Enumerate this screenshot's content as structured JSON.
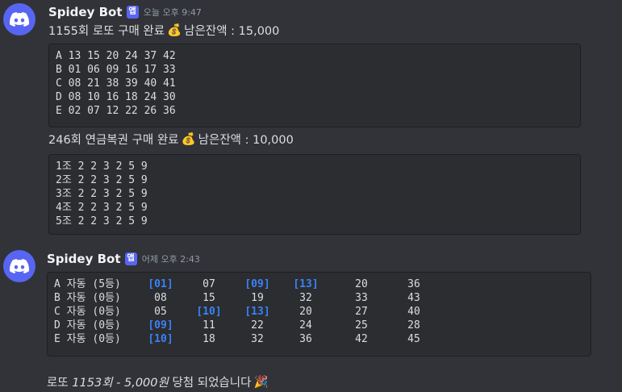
{
  "messages": [
    {
      "username": "Spidey Bot",
      "badge": "앱",
      "timestamp": "오늘 오후 9:47",
      "line1": {
        "text_a": "1155회 로또 구매 완료",
        "emoji": "💰",
        "text_b": "남은잔액 : 15,000"
      },
      "code1": [
        "A 13 15 20 24 37 42",
        "B 01 06 09 16 17 33",
        "C 08 21 38 39 40 41",
        "D 08 10 16 18 24 30",
        "E 02 07 12 22 26 36"
      ],
      "line2": {
        "text_a": "246회 연금복권 구매 완료",
        "emoji": "💰",
        "text_b": "남은잔액 : 10,000"
      },
      "code2": [
        "1조 2 2 3 2 5 9",
        "2조 2 2 3 2 5 9",
        "3조 2 2 3 2 5 9",
        "4조 2 2 3 2 5 9",
        "5조 2 2 3 2 5 9"
      ]
    },
    {
      "username": "Spidey Bot",
      "badge": "앱",
      "timestamp": "어제 오후 2:43",
      "table": [
        {
          "label": "A 자동 (5등)",
          "cells": [
            "[01]",
            "07",
            "[09]",
            "[13]",
            "20",
            "36"
          ],
          "hl": [
            true,
            false,
            true,
            true,
            false,
            false
          ]
        },
        {
          "label": "B 자동 (0등)",
          "cells": [
            "08",
            "15",
            "19",
            "32",
            "33",
            "43"
          ],
          "hl": [
            false,
            false,
            false,
            false,
            false,
            false
          ]
        },
        {
          "label": "C 자동 (0등)",
          "cells": [
            "05",
            "[10]",
            "[13]",
            "20",
            "27",
            "40"
          ],
          "hl": [
            false,
            true,
            true,
            false,
            false,
            false
          ]
        },
        {
          "label": "D 자동 (0등)",
          "cells": [
            "[09]",
            "11",
            "22",
            "24",
            "25",
            "28"
          ],
          "hl": [
            true,
            false,
            false,
            false,
            false,
            false
          ]
        },
        {
          "label": "E 자동 (0등)",
          "cells": [
            "[10]",
            "18",
            "32",
            "36",
            "42",
            "45"
          ],
          "hl": [
            true,
            false,
            false,
            false,
            false,
            false
          ]
        }
      ],
      "result": {
        "prefix": "로또",
        "round": "1153회 - 5,000원",
        "suffix": "당첨 되었습니다",
        "emoji": "🎉"
      }
    }
  ],
  "colors": {
    "background": "#313338",
    "accent": "#5865f2",
    "highlight": "#3b82f6"
  }
}
